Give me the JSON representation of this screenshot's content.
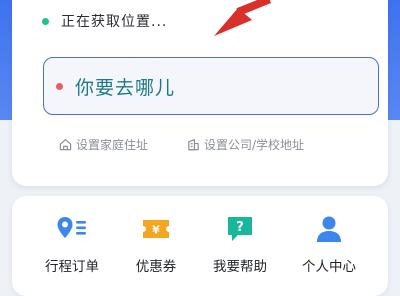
{
  "location": {
    "status_text": "正在获取位置..."
  },
  "destination": {
    "placeholder": "你要去哪儿"
  },
  "quick_addresses": [
    {
      "label": "设置家庭住址",
      "icon": "home-icon"
    },
    {
      "label": "设置公司/学校地址",
      "icon": "building-icon"
    }
  ],
  "menu": [
    {
      "label": "行程订单",
      "icon": "order-location-icon"
    },
    {
      "label": "优惠券",
      "icon": "coupon-icon"
    },
    {
      "label": "我要帮助",
      "icon": "help-icon"
    },
    {
      "label": "个人中心",
      "icon": "user-icon"
    }
  ],
  "colors": {
    "header_blue": "#3f72ef",
    "status_dot": "#1fbf8f",
    "destination_dot": "#ea5c6b",
    "destination_border": "#4a6fe0",
    "coupon": "#f4a623",
    "help": "#19b79a",
    "user": "#3d86ee",
    "arrow": "#d9302c"
  }
}
